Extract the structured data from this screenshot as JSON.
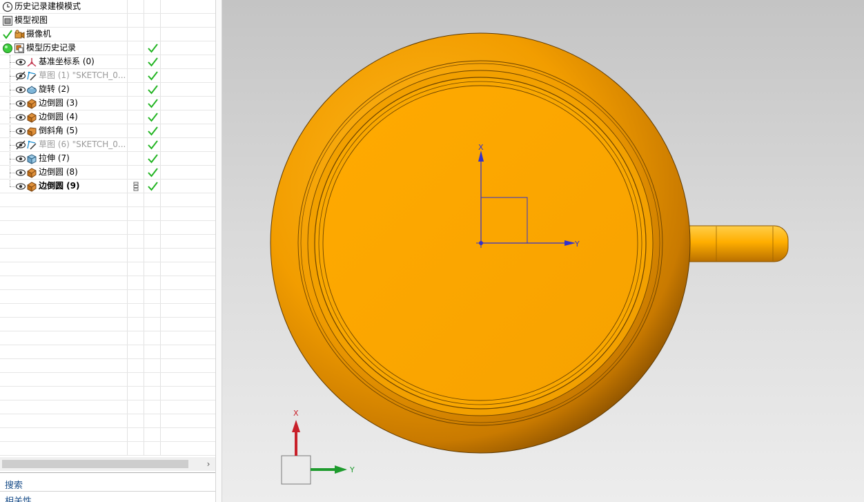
{
  "navigator": {
    "rows": [
      {
        "label": "历史记录建模模式",
        "icon": "clock-icon",
        "check": false,
        "state": "normal"
      },
      {
        "label": "模型视图",
        "icon": "model-views-icon",
        "check": false,
        "state": "normal"
      },
      {
        "label": "摄像机",
        "icon": "camera-icon",
        "check": false,
        "state": "normal",
        "lead": "green-check-icon"
      },
      {
        "label": "模型历史记录",
        "icon": "model-history-icon",
        "check": true,
        "state": "normal",
        "lead": "green-ball-icon"
      },
      {
        "label": "基准坐标系 (0)",
        "icon": "datum-csys-icon",
        "check": true,
        "state": "normal"
      },
      {
        "label": "草图 (1) \"SKETCH_0...",
        "icon": "sketch-icon",
        "check": true,
        "state": "dim"
      },
      {
        "label": "旋转 (2)",
        "icon": "revolve-icon",
        "check": true,
        "state": "normal"
      },
      {
        "label": "边倒圆 (3)",
        "icon": "edge-blend-icon",
        "check": true,
        "state": "normal"
      },
      {
        "label": "边倒圆 (4)",
        "icon": "edge-blend-icon",
        "check": true,
        "state": "normal"
      },
      {
        "label": "倒斜角 (5)",
        "icon": "chamfer-icon",
        "check": true,
        "state": "normal"
      },
      {
        "label": "草图 (6) \"SKETCH_0...",
        "icon": "sketch-icon",
        "check": true,
        "state": "dim"
      },
      {
        "label": "拉伸 (7)",
        "icon": "extrude-icon",
        "check": true,
        "state": "normal"
      },
      {
        "label": "边倒圆 (8)",
        "icon": "edge-blend-icon",
        "check": true,
        "state": "normal"
      },
      {
        "label": "边倒圆 (9)",
        "icon": "edge-blend-icon",
        "check": true,
        "state": "bold"
      }
    ],
    "sections": {
      "search": "搜索",
      "dependencies": "相关性"
    }
  },
  "viewport": {
    "csys_x": "X",
    "csys_y": "Y",
    "triad_x": "X",
    "triad_y": "Y"
  },
  "colors": {
    "part": "#FFAB00",
    "check": "#22B422",
    "axis": "#3232CC",
    "triad_x": "#C8202A",
    "triad_y": "#1E9B2D"
  }
}
